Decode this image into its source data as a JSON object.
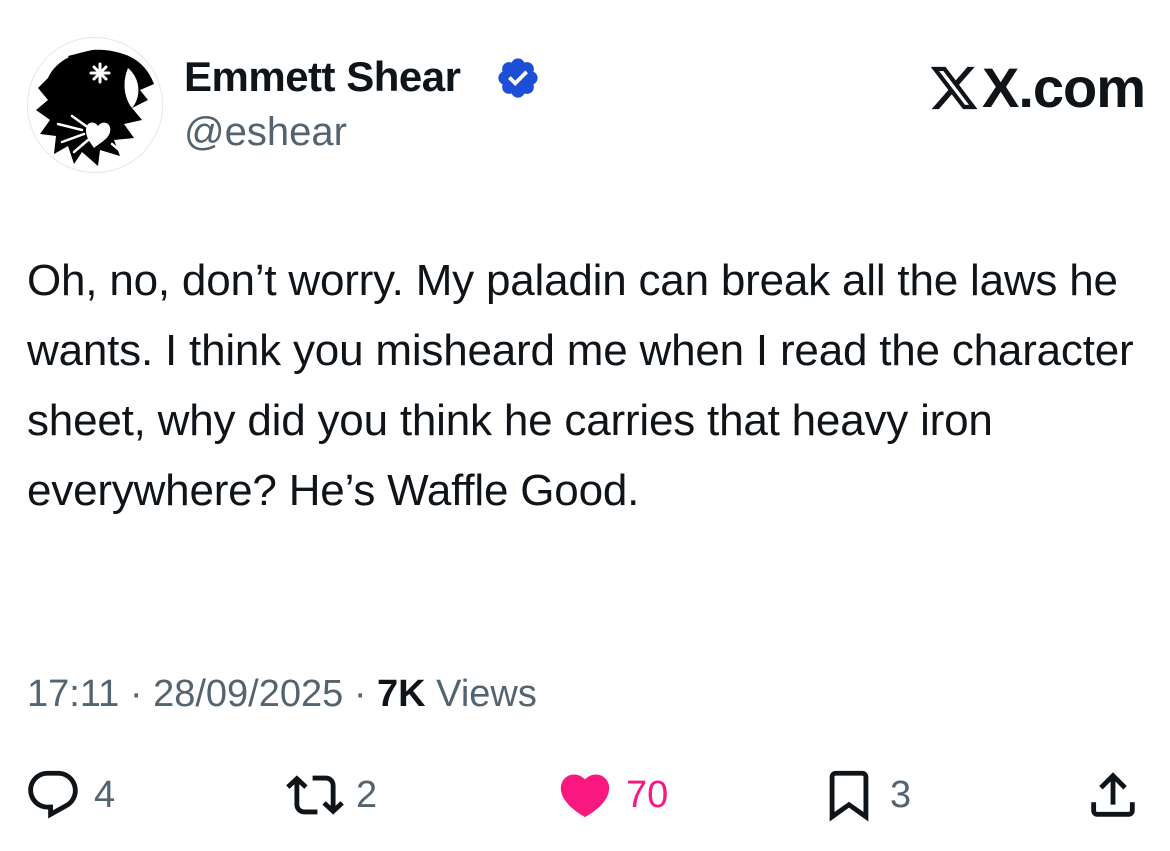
{
  "author": {
    "name": "Emmett Shear",
    "handle": "@eshear",
    "verified": true,
    "avatar_icon": "black-white-abstract-avatar-icon",
    "verified_color": "#1d4ed8"
  },
  "site": {
    "label": "X.com",
    "mark_icon": "x-logo-icon"
  },
  "tweet": {
    "text": "Oh, no, don’t worry. My paladin can break all the laws he wants. I think you misheard me when I read the character sheet, why did you think he carries that heavy iron everywhere? He’s Waffle Good."
  },
  "meta": {
    "time": "17:11",
    "sep1": "·",
    "date": "28/09/2025",
    "sep2": "·",
    "views_count": "7K",
    "views_label": "Views"
  },
  "actions": {
    "replies": {
      "icon": "reply-icon",
      "count": "4"
    },
    "reposts": {
      "icon": "repost-icon",
      "count": "2"
    },
    "likes": {
      "icon": "heart-icon",
      "count": "70",
      "color": "#f91880"
    },
    "bookmarks": {
      "icon": "bookmark-icon",
      "count": "3"
    },
    "share": {
      "icon": "share-icon"
    }
  },
  "colors": {
    "text": "#0f1419",
    "secondary": "#536471",
    "like": "#f91880"
  }
}
